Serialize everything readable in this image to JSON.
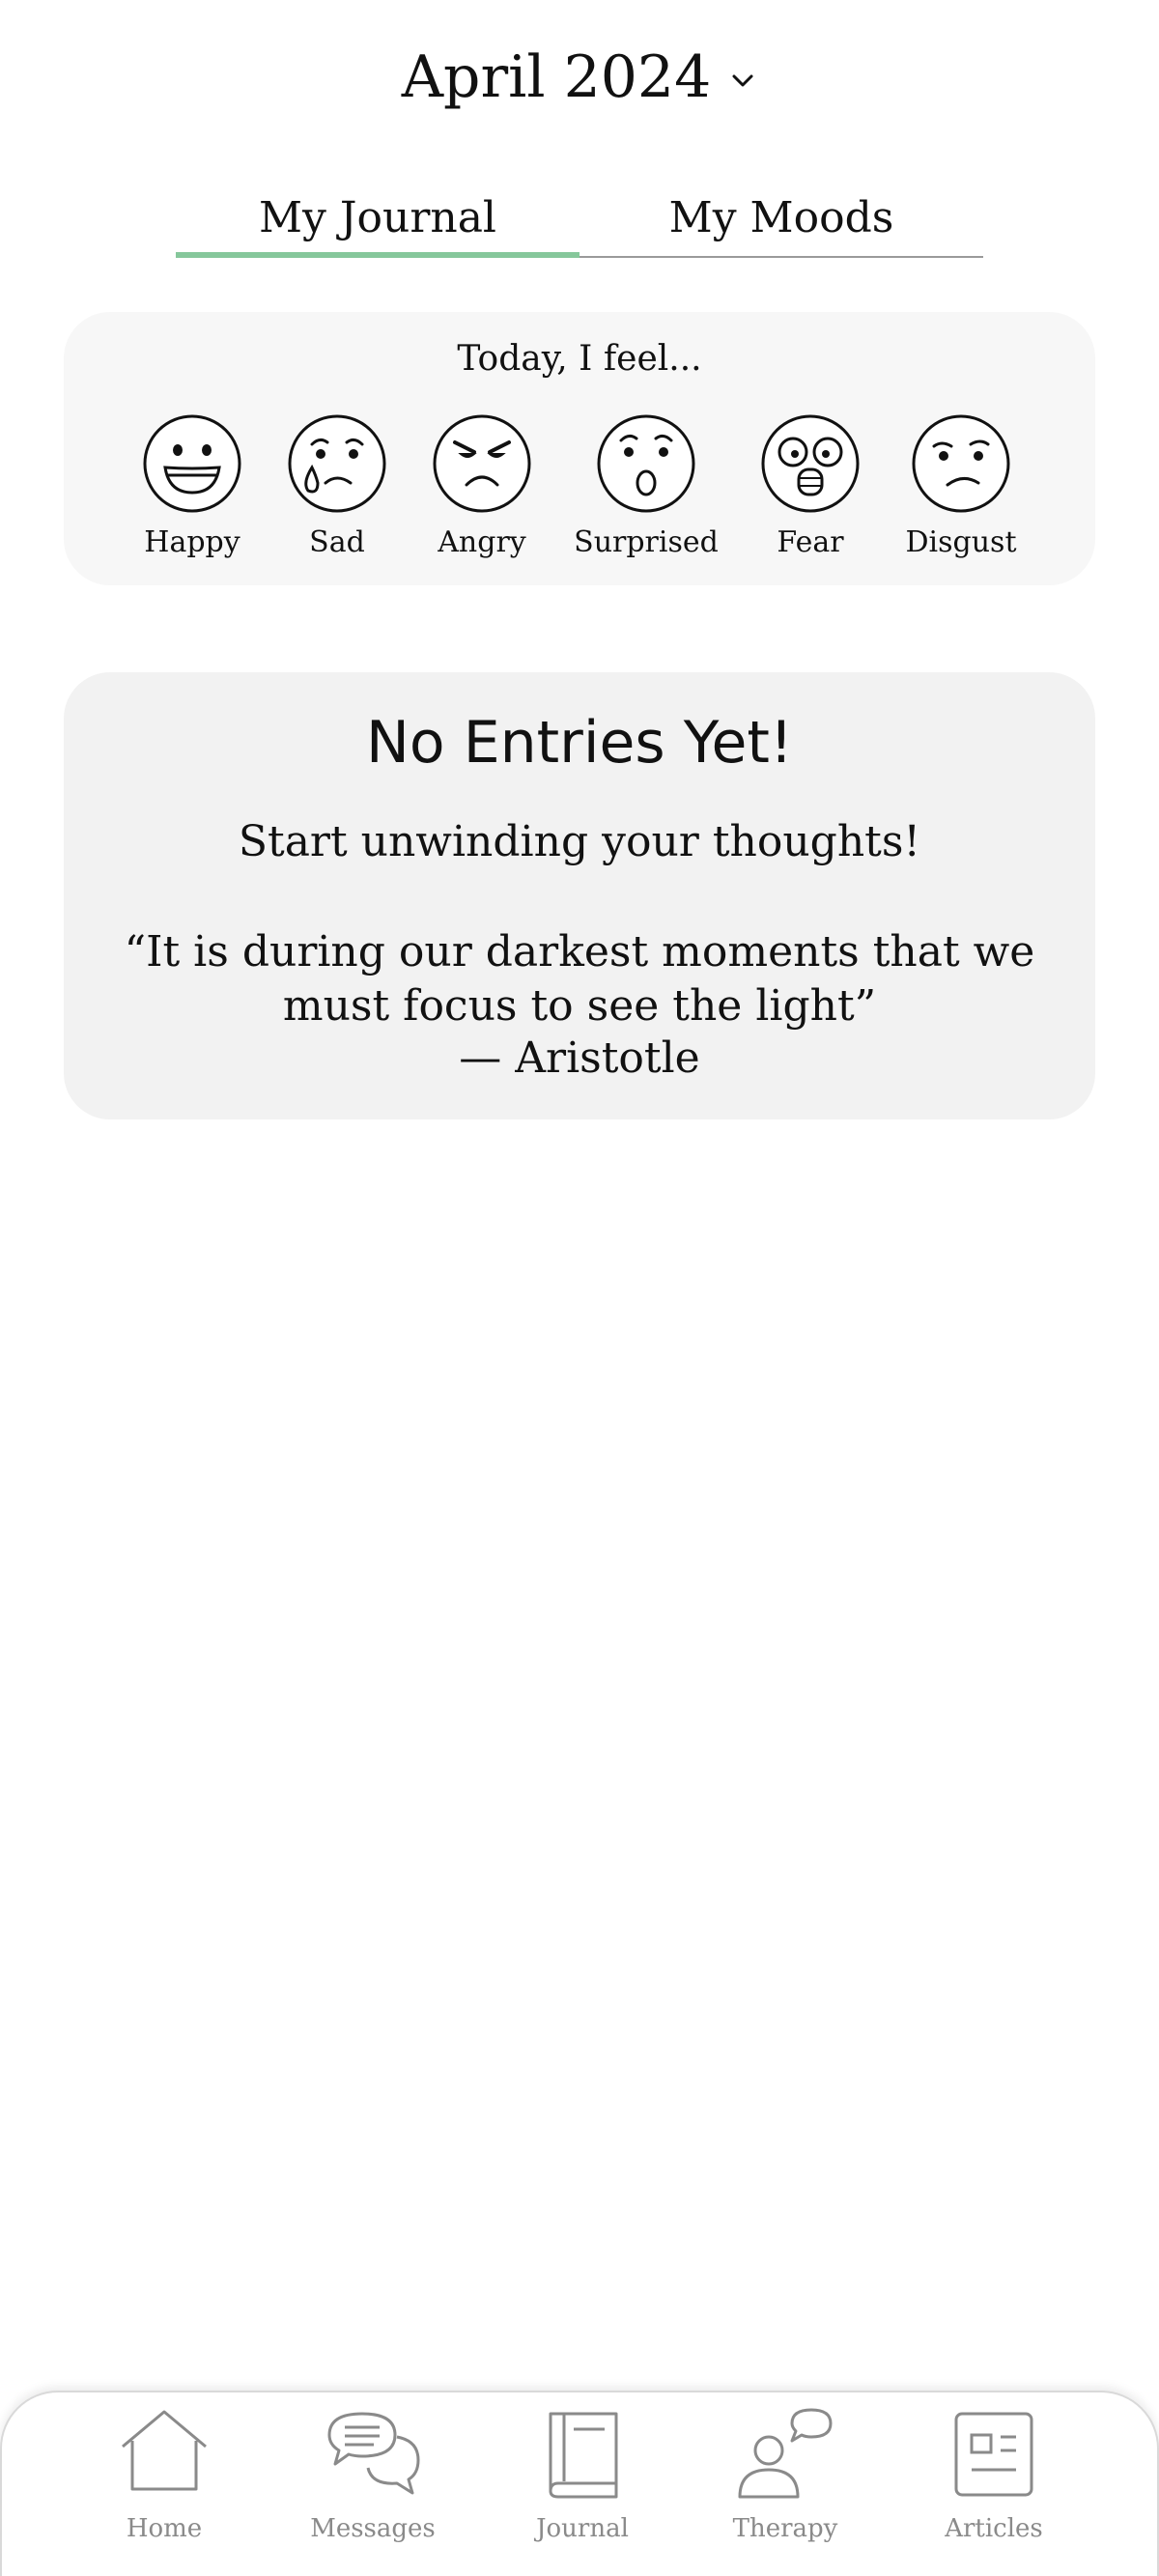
{
  "header": {
    "month_label": "April 2024",
    "dropdown_icon": "chevron-down-icon"
  },
  "tabs": [
    {
      "label": "My Journal",
      "active": true
    },
    {
      "label": "My Moods",
      "active": false
    }
  ],
  "colors": {
    "accent": "#86c79b",
    "card_bg": "#f7f7f7",
    "empty_card_bg": "#f2f2f2",
    "nav_label": "#8a8a8a"
  },
  "mood_card": {
    "prompt": "Today, I feel...",
    "moods": [
      {
        "label": "Happy",
        "icon": "happy-face-icon"
      },
      {
        "label": "Sad",
        "icon": "sad-face-icon"
      },
      {
        "label": "Angry",
        "icon": "angry-face-icon"
      },
      {
        "label": "Surprised",
        "icon": "surprised-face-icon"
      },
      {
        "label": "Fear",
        "icon": "fear-face-icon"
      },
      {
        "label": "Disgust",
        "icon": "disgust-face-icon"
      }
    ]
  },
  "empty_state": {
    "title": "No Entries Yet!",
    "subtitle": "Start unwinding your thoughts!",
    "quote": "“It is during our darkest moments that we must focus to see the light”",
    "author": "— Aristotle"
  },
  "bottom_nav": {
    "items": [
      {
        "label": "Home",
        "icon": "home-icon"
      },
      {
        "label": "Messages",
        "icon": "messages-icon"
      },
      {
        "label": "Journal",
        "icon": "journal-icon"
      },
      {
        "label": "Therapy",
        "icon": "therapy-icon"
      },
      {
        "label": "Articles",
        "icon": "articles-icon"
      }
    ]
  }
}
